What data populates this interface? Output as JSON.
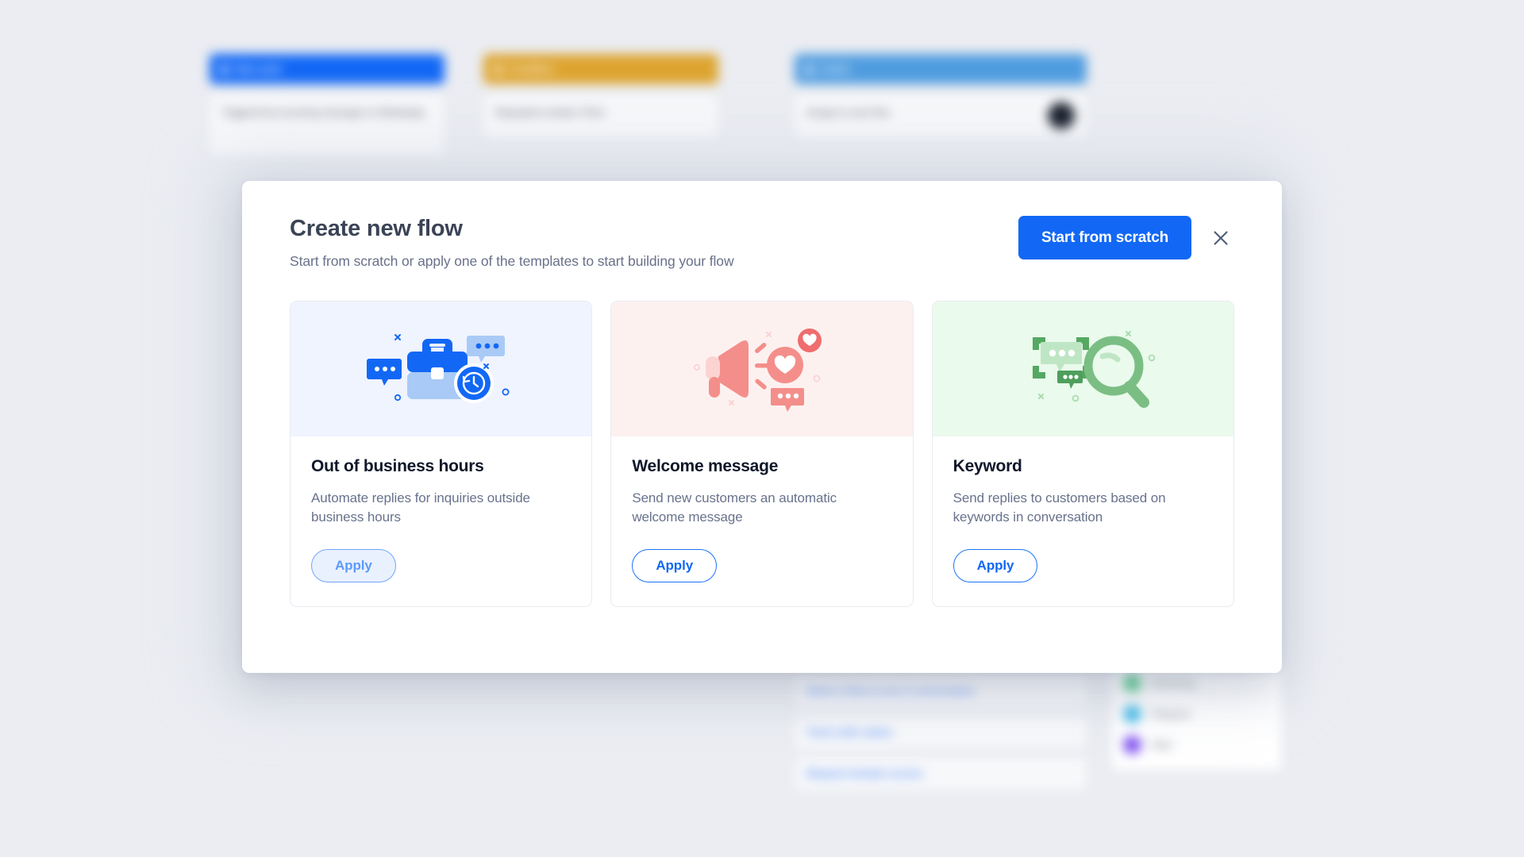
{
  "background": {
    "page_bg": "#ebedf2",
    "flows": [
      {
        "header_label": "New cycle",
        "header_color": "#1268f5",
        "body_text": "Triggered by incoming message on WhatsApp"
      },
      {
        "header_label": "Condition",
        "header_color": "#dda430",
        "body_text": "Repeated contains 'Flow'"
      },
      {
        "header_label": "Action",
        "header_color": "#4f9ce0",
        "body_text": "Assign to user flow",
        "has_avatar": true
      }
    ],
    "links": [
      "Select a flow to use in conversation",
      "Track order status",
      "Request member access"
    ],
    "channels": [
      {
        "name": "WhatsApp",
        "color": "#3fc47c"
      },
      {
        "name": "Telegram",
        "color": "#3cb8e8"
      },
      {
        "name": "Viber",
        "color": "#7c4df0"
      }
    ]
  },
  "modal": {
    "title": "Create new flow",
    "subtitle": "Start from scratch or apply one of the templates to start building your flow",
    "primary_button": "Start from scratch",
    "primary_button_color": "#1268f5",
    "close_icon": "close-icon",
    "templates": [
      {
        "title": "Out of business hours",
        "description": "Automate replies for inquiries outside business hours",
        "apply_label": "Apply",
        "apply_state": "hovered",
        "illustration": "briefcase-clock-icon",
        "illo_bg": "#eff4fe",
        "accent": "#1268f5",
        "accent_light": "#a9caf6"
      },
      {
        "title": "Welcome message",
        "description": "Send new customers an automatic welcome message",
        "apply_label": "Apply",
        "apply_state": "default",
        "illustration": "megaphone-heart-icon",
        "illo_bg": "#fdf1f0",
        "accent": "#f48e8a",
        "accent_light": "#fbd3d1"
      },
      {
        "title": "Keyword",
        "description": "Send replies to customers based on keywords in conversation",
        "apply_label": "Apply",
        "apply_state": "default",
        "illustration": "magnifier-chat-icon",
        "illo_bg": "#eafaec",
        "accent": "#7bbe84",
        "accent_light": "#bfe6c4"
      }
    ]
  }
}
